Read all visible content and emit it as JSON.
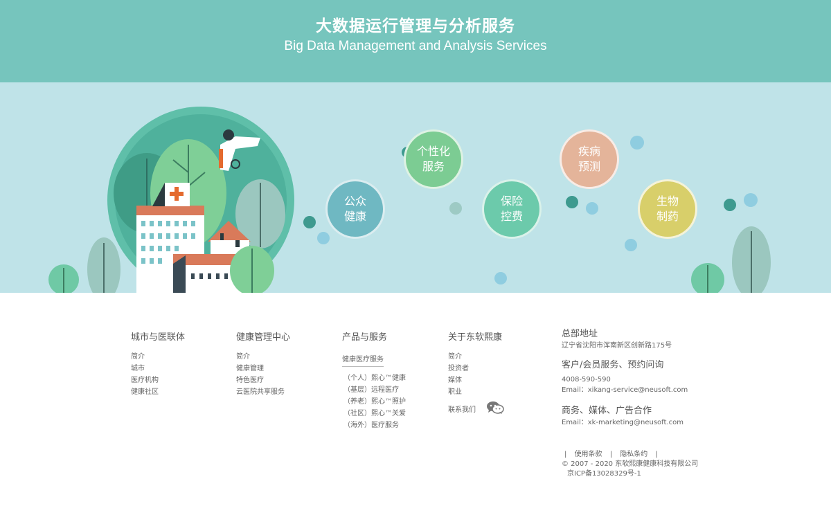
{
  "header": {
    "title_zh": "大数据运行管理与分析服务",
    "title_en": "Big Data Management and Analysis Services"
  },
  "bubbles": [
    {
      "label_line1": "公众",
      "label_line2": "健康",
      "color": "#6fb8c2"
    },
    {
      "label_line1": "个性化",
      "label_line2": "服务",
      "color": "#7ccc93"
    },
    {
      "label_line1": "保险",
      "label_line2": "控费",
      "color": "#6ccaab"
    },
    {
      "label_line1": "疾病",
      "label_line2": "预测",
      "color": "#e4b49a"
    },
    {
      "label_line1": "生物",
      "label_line2": "制药",
      "color": "#d8cf6a"
    }
  ],
  "footer": {
    "col1": {
      "heading": "城市与医联体",
      "items": [
        "简介",
        "城市",
        "医疗机构",
        "健康社区"
      ]
    },
    "col2": {
      "heading": "健康管理中心",
      "items": [
        "简介",
        "健康管理",
        "特色医疗",
        "云医院共享服务"
      ]
    },
    "col3": {
      "heading": "产品与服务",
      "subheading": "健康医疗服务",
      "items": [
        "（个人）熙心™健康",
        "（基层）远程医疗",
        "（养老）熙心™照护",
        "（社区）熙心™关爱",
        "（海外）医疗服务"
      ]
    },
    "col4": {
      "heading": "关于东软熙康",
      "items": [
        "简介",
        "投资者",
        "媒体",
        "职业"
      ],
      "contact_label": "联系我们"
    },
    "contact": {
      "hq_heading": "总部地址",
      "hq_address": "辽宁省沈阳市浑南新区创新路175号",
      "service_heading": "客户/会员服务、预约问询",
      "service_phone": "4008-590-590",
      "service_email": "Email：xikang-service@neusoft.com",
      "business_heading": "商务、媒体、广告合作",
      "business_email": "Email：xk-marketing@neusoft.com"
    },
    "legal": {
      "sep": "|",
      "terms": "使用条款",
      "privacy": "隐私条约",
      "copyright": "© 2007 - 2020 东软熙康健康科技有限公司",
      "icp": "京ICP备13028329号-1"
    }
  },
  "colors": {
    "banner": "#76c5bd",
    "scene_bg": "#bfe3e8"
  }
}
